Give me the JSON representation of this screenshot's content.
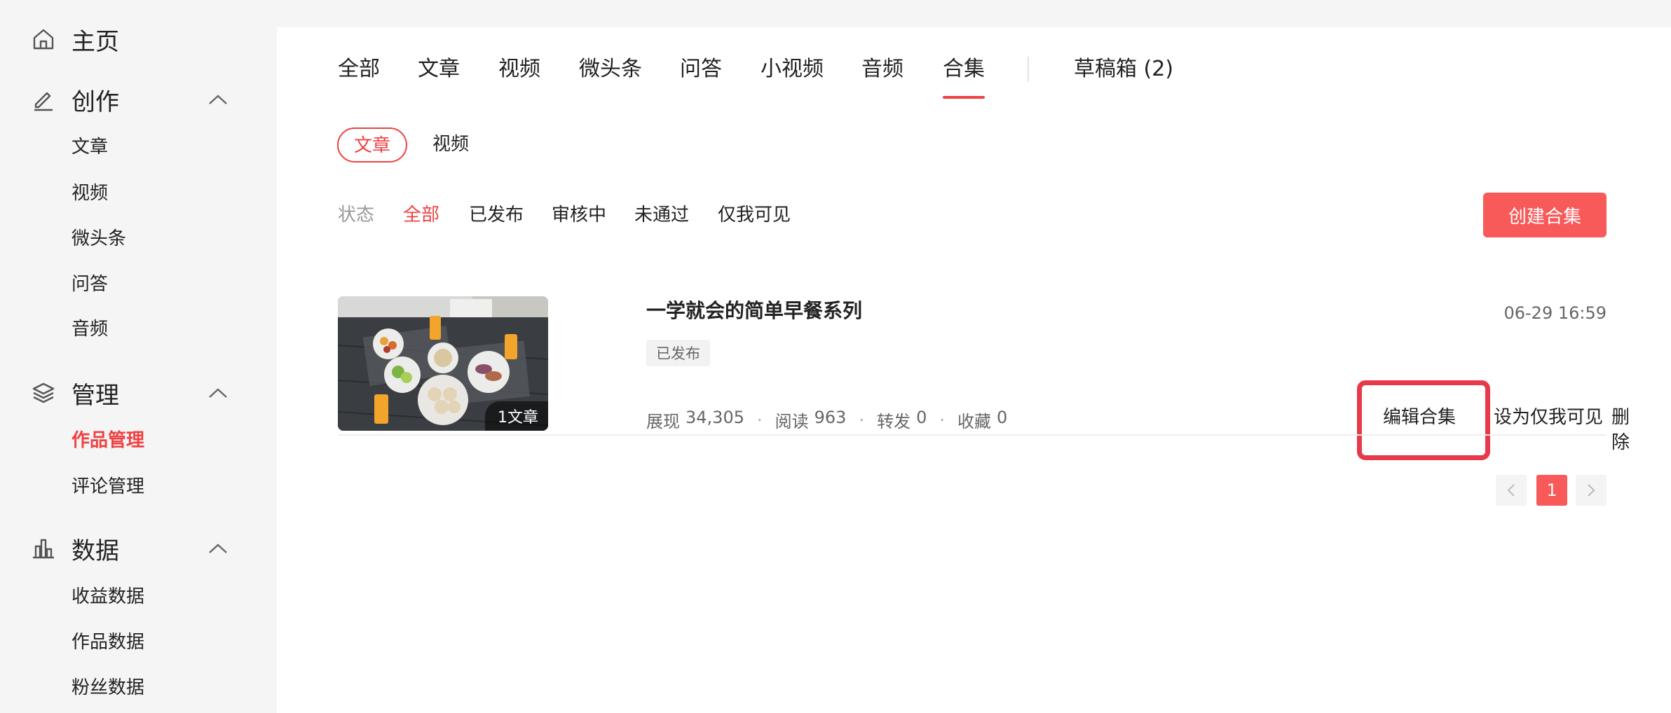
{
  "sidebar": {
    "home": {
      "label": "主页",
      "icon": "home-icon"
    },
    "create": {
      "label": "创作",
      "icon": "pen-icon",
      "items": [
        "文章",
        "视频",
        "微头条",
        "问答",
        "音频"
      ]
    },
    "manage": {
      "label": "管理",
      "icon": "layers-icon",
      "items": [
        "作品管理",
        "评论管理"
      ],
      "active_item": "作品管理"
    },
    "data": {
      "label": "数据",
      "icon": "bar-chart-icon",
      "items": [
        "收益数据",
        "作品数据",
        "粉丝数据"
      ]
    }
  },
  "tabs": {
    "items": [
      "全部",
      "文章",
      "视频",
      "微头条",
      "问答",
      "小视频",
      "音频",
      "合集"
    ],
    "active": "合集",
    "drafts": "草稿箱 (2)"
  },
  "subtypes": {
    "active": "文章",
    "other": "视频"
  },
  "filters": {
    "label": "状态",
    "items": [
      "全部",
      "已发布",
      "审核中",
      "未通过",
      "仅我可见"
    ],
    "active": "全部"
  },
  "create_button": "创建合集",
  "collection": {
    "title": "一学就会的简单早餐系列",
    "status": "已发布",
    "time": "06-29 16:59",
    "thumb_badge": "1文章",
    "stats": [
      {
        "label": "展现",
        "value": "34,305"
      },
      {
        "label": "阅读",
        "value": "963"
      },
      {
        "label": "转发",
        "value": "0"
      },
      {
        "label": "收藏",
        "value": "0"
      }
    ],
    "actions": [
      "编辑合集",
      "设为仅我可见",
      "删除"
    ]
  },
  "pagination": {
    "current": "1"
  },
  "colors": {
    "accent": "#f04142",
    "button": "#f85959",
    "highlight": "#e8394a"
  }
}
